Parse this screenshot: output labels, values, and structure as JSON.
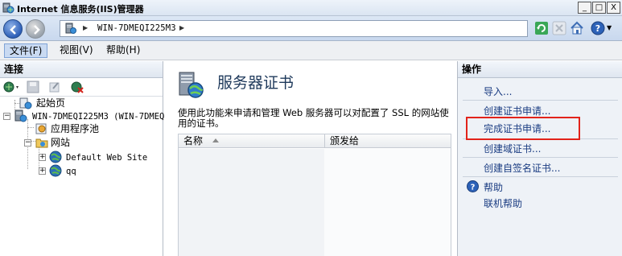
{
  "window": {
    "title": "Internet 信息服务(IIS)管理器",
    "buttons": [
      "_",
      "□",
      "X"
    ]
  },
  "address": {
    "breadcrumb": "WIN-7DMEQI225M3"
  },
  "menu": {
    "items": [
      "文件(F)",
      "视图(V)",
      "帮助(H)"
    ]
  },
  "connections": {
    "header": "连接",
    "tree": {
      "start_page": "起始页",
      "server": "WIN-7DMEQI225M3 (WIN-7DMEQ",
      "app_pools": "应用程序池",
      "sites": "网站",
      "default_site": "Default Web Site",
      "qq_site": "qq"
    }
  },
  "main": {
    "title": "服务器证书",
    "description": "使用此功能来申请和管理 Web 服务器可以对配置了 SSL 的网站使用的证书。",
    "columns": [
      "名称",
      "颁发给"
    ]
  },
  "actions": {
    "header": "操作",
    "items": [
      "导入...",
      "创建证书申请...",
      "完成证书申请...",
      "创建域证书...",
      "创建自签名证书..."
    ],
    "help": "帮助",
    "online_help": "联机帮助"
  },
  "colors": {
    "highlight": "#e2231a",
    "link": "#1a3c82",
    "title": "#1e395b"
  }
}
